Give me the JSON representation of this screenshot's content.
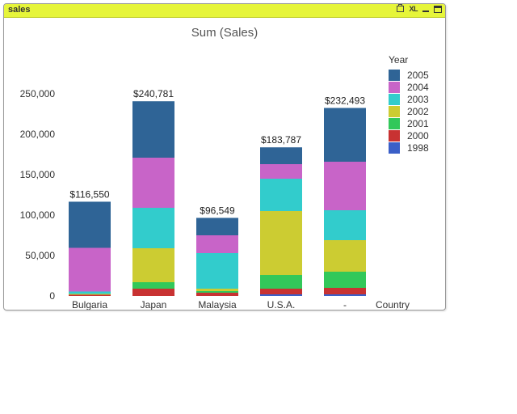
{
  "window": {
    "title": "sales",
    "icons": [
      "print-icon",
      "xl-icon",
      "minimize-icon",
      "maximize-icon"
    ],
    "xl_label": "XL"
  },
  "chart_data": {
    "type": "bar",
    "stacked": true,
    "title": "Sum (Sales)",
    "xlabel": "Country",
    "ylabel": "",
    "ylim": [
      0,
      250000
    ],
    "yticks": [
      0,
      50000,
      100000,
      150000,
      200000,
      250000
    ],
    "ytick_labels": [
      "0",
      "50,000",
      "100,000",
      "150,000",
      "200,000",
      "250,000"
    ],
    "categories": [
      "Bulgaria",
      "Japan",
      "Malaysia",
      "U.S.A.",
      "-"
    ],
    "totals": [
      "$116,550",
      "$240,781",
      "$96,549",
      "$183,787",
      "$232,493"
    ],
    "total_values": [
      116550,
      240781,
      96549,
      183787,
      232493
    ],
    "legend_title": "Year",
    "legend_position": "right",
    "series": [
      {
        "name": "1998",
        "color": "#3a5fc8",
        "values": [
          0,
          0,
          0,
          2000,
          2000
        ]
      },
      {
        "name": "2000",
        "color": "#c83232",
        "values": [
          1500,
          9000,
          4000,
          7000,
          8000
        ]
      },
      {
        "name": "2001",
        "color": "#32c85a",
        "values": [
          0,
          8000,
          2000,
          17000,
          20000
        ]
      },
      {
        "name": "2002",
        "color": "#cccc32",
        "values": [
          1000,
          42000,
          3000,
          79000,
          39000
        ]
      },
      {
        "name": "2003",
        "color": "#32cccc",
        "values": [
          3000,
          50000,
          44000,
          40000,
          37000
        ]
      },
      {
        "name": "2004",
        "color": "#c864c8",
        "values": [
          54000,
          62000,
          22000,
          18000,
          60000
        ]
      },
      {
        "name": "2005",
        "color": "#2f6496",
        "values": [
          57050,
          69781,
          21549,
          20787,
          66493
        ]
      }
    ],
    "legend_order": [
      "2005",
      "2004",
      "2003",
      "2002",
      "2001",
      "2000",
      "1998"
    ]
  }
}
